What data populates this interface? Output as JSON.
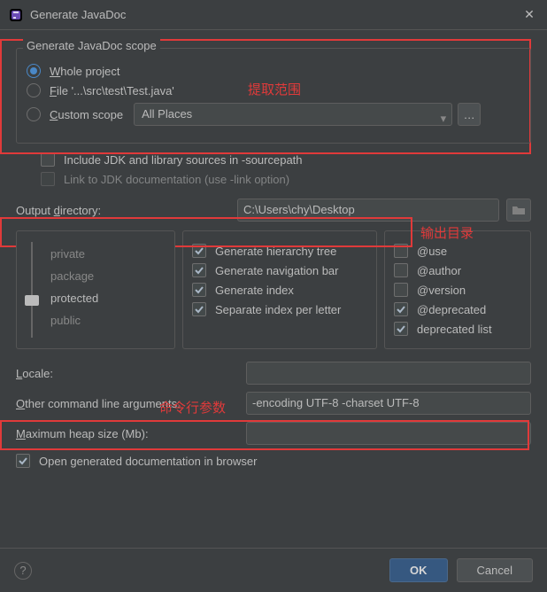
{
  "title": "Generate JavaDoc",
  "scope": {
    "legend": "Generate JavaDoc scope",
    "whole": "Whole project",
    "file": "File '...\\src\\test\\Test.java'",
    "custom": "Custom scope",
    "allPlaces": "All Places",
    "anno": "提取范围"
  },
  "includeJDK": "Include JDK and library sources in -sourcepath",
  "linkJDK": "Link to JDK documentation (use -link option)",
  "output": {
    "label": "Output directory:",
    "value": "C:\\Users\\chy\\Desktop",
    "anno": "输出目录"
  },
  "levels": {
    "private": "private",
    "package": "package",
    "protected": "protected",
    "public": "public"
  },
  "genOpts": {
    "hierarchy": "Generate hierarchy tree",
    "navbar": "Generate navigation bar",
    "index": "Generate index",
    "separate": "Separate index per letter"
  },
  "tags": {
    "use": "@use",
    "author": "@author",
    "version": "@version",
    "deprecated": "@deprecated",
    "deplist": "deprecated list"
  },
  "locale": "Locale:",
  "cmdAnno": "命令行参数",
  "otherArgs": {
    "label": "Other command line arguments:",
    "value": "-encoding UTF-8 -charset UTF-8"
  },
  "heap": "Maximum heap size (Mb):",
  "openBrowser": "Open generated documentation in browser",
  "ok": "OK",
  "cancel": "Cancel"
}
